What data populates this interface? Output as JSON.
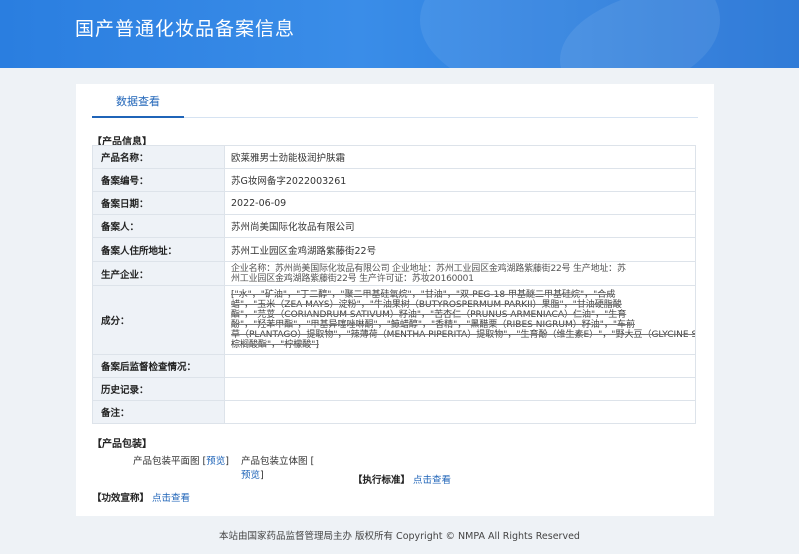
{
  "header": {
    "title": "国产普通化妆品备案信息"
  },
  "tab": {
    "label": "数据查看"
  },
  "product_section": {
    "title": "【产品信息】",
    "rows": [
      {
        "label": "产品名称：",
        "value": "欧莱雅男士劲能极润护肤霜"
      },
      {
        "label": "备案编号：",
        "value": "苏G妆网备字2022003261"
      },
      {
        "label": "备案日期：",
        "value": "2022-06-09"
      },
      {
        "label": "备案人：",
        "value": "苏州尚美国际化妆品有限公司"
      },
      {
        "label": "备案人住所地址：",
        "value": "苏州工业园区金鸡湖路紫藤街22号"
      },
      {
        "label": "生产企业：",
        "value_line1": "企业名称：苏州尚美国际化妆品有限公司 企业地址：苏州工业园区金鸡湖路紫藤街22号 生产地址：苏",
        "value_line2": "州工业园区金鸡湖路紫藤街22号 生产许可证：苏妆20160001"
      },
      {
        "label": "成分：",
        "lines": [
          "[\"水\"，\"矿油\"，\"丁二醇\"，\"聚二甲基硅氧烷\"，\"甘油\"，\"双-PEG-18 甲基醚二甲基硅烷\"，\"合成",
          "蜡\"，\"玉米（ZEA MAYS）淀粉\"，\"牛油果树（BUTYROSPERMUM PARKII）果脂\"，\"甘油硬脂酸",
          "酯\"，\"芫荽（CORIANDRUM SATIVUM）籽油\"，\"苦杏仁（PRUNUS ARMENIACA）仁油\"，\"生育",
          "酚\"，\"羟苯甲酯\"，\"甲基异噻唑啉酮\"，\"鲸蜡醇\"，\"香精\"，\"黑醋栗（RIBES NIGRUM）籽油\"，\"车前",
          "草（PLANTAGO）提取物\"，\"辣薄荷（MENTHA PIPERITA）提取物\"，\"生育酚（维生素E）\"，\"野大豆（GLYCINE SOJA）油\"，\"抗坏血酸",
          "棕榈酸酯\"，\"柠檬酸\"]"
        ]
      },
      {
        "label": "备案后监督检查情况：",
        "value": ""
      },
      {
        "label": "历史记录：",
        "value": ""
      },
      {
        "label": "备注：",
        "value": ""
      }
    ]
  },
  "packaging": {
    "title": "【产品包装】",
    "flat_label": "产品包装平面图",
    "flat_link": "预览",
    "solid_label": "产品包装立体图",
    "solid_link": "预览",
    "open_bracket": "[",
    "close_bracket": "]",
    "standard_label": "【执行标准】",
    "standard_link": "点击查看"
  },
  "efficacy": {
    "label": "【功效宣称】",
    "link": "点击查看"
  },
  "footer": {
    "text": "本站由国家药品监督管理局主办 版权所有 Copyright © NMPA All Rights Reserved"
  },
  "colors": {
    "header": "#2a7ee0",
    "link": "#1f64b8",
    "label_bg": "#eef2f7"
  }
}
